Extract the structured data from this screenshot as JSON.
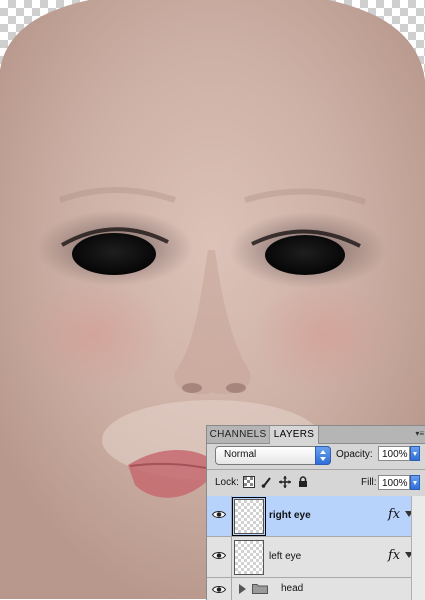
{
  "panel": {
    "tabs": [
      {
        "label": "CHANNELS",
        "active": false
      },
      {
        "label": "LAYERS",
        "active": true
      }
    ],
    "blend_mode": "Normal",
    "opacity_label": "Opacity:",
    "opacity_value": "100%",
    "lock_label": "Lock:",
    "fill_label": "Fill:",
    "fill_value": "100%"
  },
  "layers": [
    {
      "name": "right eye",
      "selected": true,
      "visible": true,
      "fx": "fx",
      "icon": "eye-icon"
    },
    {
      "name": "left eye",
      "selected": false,
      "visible": true,
      "fx": "fx",
      "icon": "eye-icon"
    },
    {
      "name": "head",
      "selected": false,
      "visible": true,
      "type": "group",
      "icon": "folder-icon"
    }
  ],
  "colors": {
    "selection": "#b7d3fb",
    "accent_blue": "#2f6ed8",
    "panel_bg": "#d6d6d6"
  }
}
